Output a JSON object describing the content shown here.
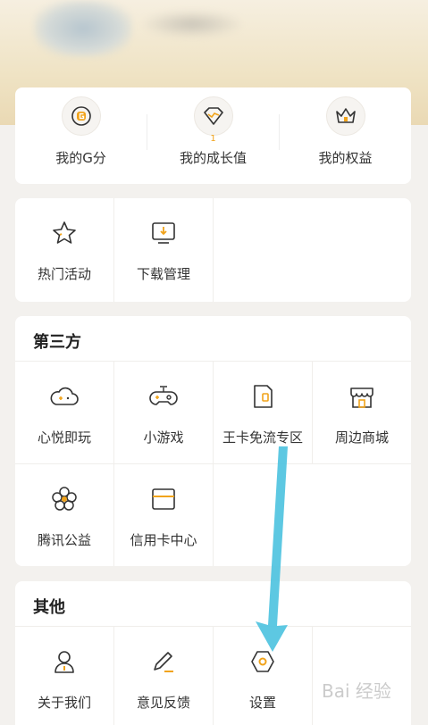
{
  "stats": [
    {
      "label": "我的G分",
      "icon": "g-score-icon",
      "badge": ""
    },
    {
      "label": "我的成长值",
      "icon": "diamond-growth-icon",
      "badge": "1"
    },
    {
      "label": "我的权益",
      "icon": "crown-icon",
      "badge": ""
    }
  ],
  "tools": [
    {
      "label": "热门活动",
      "icon": "star-icon"
    },
    {
      "label": "下载管理",
      "icon": "download-monitor-icon"
    }
  ],
  "third_party": {
    "title": "第三方",
    "items": [
      {
        "label": "心悦即玩",
        "icon": "cloud-gamepad-icon"
      },
      {
        "label": "小游戏",
        "icon": "gamepad-icon"
      },
      {
        "label": "王卡免流专区",
        "icon": "sim-card-icon"
      },
      {
        "label": "周边商城",
        "icon": "store-icon"
      },
      {
        "label": "腾讯公益",
        "icon": "flower-icon"
      },
      {
        "label": "信用卡中心",
        "icon": "credit-card-icon"
      }
    ]
  },
  "other": {
    "title": "其他",
    "items": [
      {
        "label": "关于我们",
        "icon": "about-person-icon"
      },
      {
        "label": "意见反馈",
        "icon": "pencil-icon"
      },
      {
        "label": "设置",
        "icon": "hexagon-settings-icon"
      }
    ]
  },
  "watermark": "Bai 经验",
  "colors": {
    "accent": "#f1a31a",
    "arrow": "#4fc3e0",
    "icon_stroke": "#333333"
  }
}
